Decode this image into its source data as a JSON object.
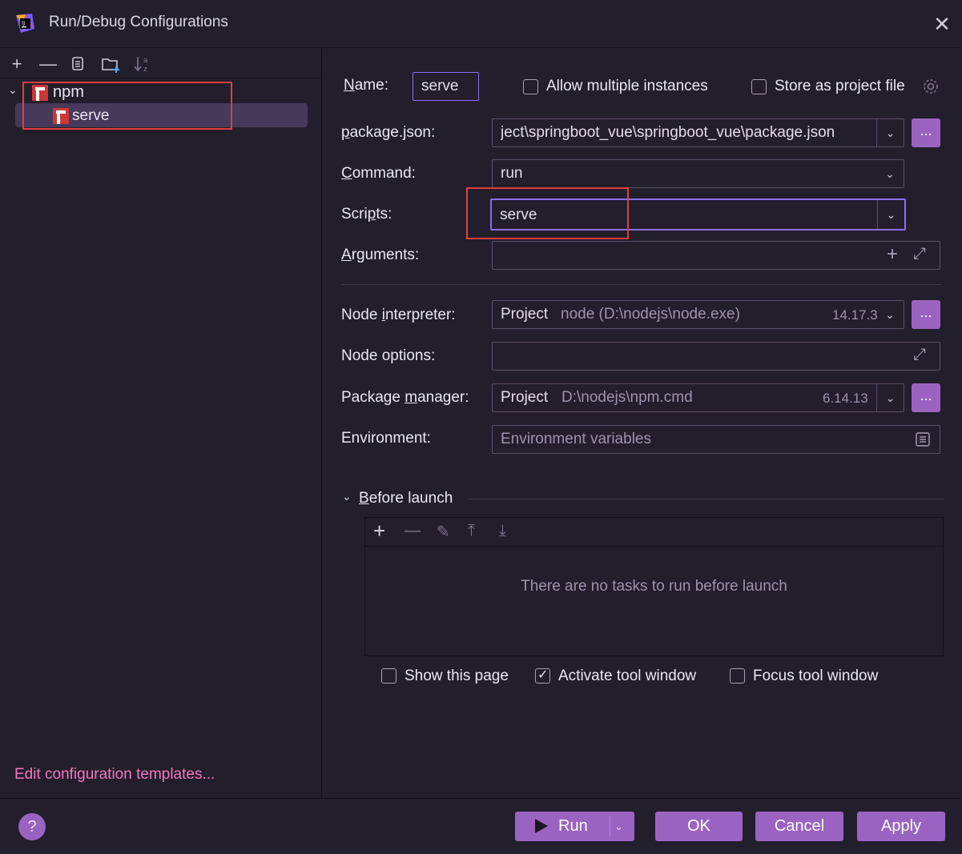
{
  "window": {
    "title": "Run/Debug Configurations",
    "close_icon": "close-icon"
  },
  "left": {
    "toolbar": [
      "add-icon",
      "remove-icon",
      "copy-icon",
      "new-folder-icon",
      "sort-icon"
    ],
    "tree": {
      "group_label": "npm",
      "items": [
        {
          "label": "serve",
          "selected": true
        }
      ]
    },
    "edit_templates_link": "Edit configuration templates..."
  },
  "form": {
    "name_label": "Name:",
    "name_value": "serve",
    "allow_multiple_label": "Allow multiple instances",
    "allow_multiple_checked": false,
    "store_as_file_label": "Store as project file",
    "store_as_file_checked": false,
    "package_json_label": "package.json:",
    "package_json_value": "ject\\springboot_vue\\springboot_vue\\package.json",
    "command_label": "Command:",
    "command_value": "run",
    "scripts_label": "Scripts:",
    "scripts_value": "serve",
    "arguments_label": "Arguments:",
    "arguments_value": "",
    "node_interpreter_label": "Node interpreter:",
    "node_interpreter_kind": "Project",
    "node_interpreter_path": "node (D:\\nodejs\\node.exe)",
    "node_interpreter_version": "14.17.3",
    "node_options_label": "Node options:",
    "node_options_value": "",
    "package_manager_label": "Package manager:",
    "package_manager_kind": "Project",
    "package_manager_path": "D:\\nodejs\\npm.cmd",
    "package_manager_version": "6.14.13",
    "environment_label": "Environment:",
    "environment_placeholder": "Environment variables",
    "browse_label": "..."
  },
  "before_launch": {
    "title": "Before launch",
    "toolbar": [
      "add-icon",
      "remove-icon",
      "edit-icon",
      "move-up-icon",
      "move-down-icon"
    ],
    "empty_text": "There are no tasks to run before launch"
  },
  "options": {
    "show_page_label": "Show this page",
    "show_page_checked": false,
    "activate_tool_window_label": "Activate tool window",
    "activate_tool_window_checked": true,
    "focus_tool_window_label": "Focus tool window",
    "focus_tool_window_checked": false
  },
  "buttons": {
    "help": "?",
    "run": "Run",
    "ok": "OK",
    "cancel": "Cancel",
    "apply": "Apply"
  },
  "colors": {
    "background": "#231e2b",
    "accent": "#9a63c1",
    "focus_border": "#8a6ff0",
    "highlight": "#e0403e",
    "link": "#f277c2",
    "npm": "#cb3837"
  }
}
